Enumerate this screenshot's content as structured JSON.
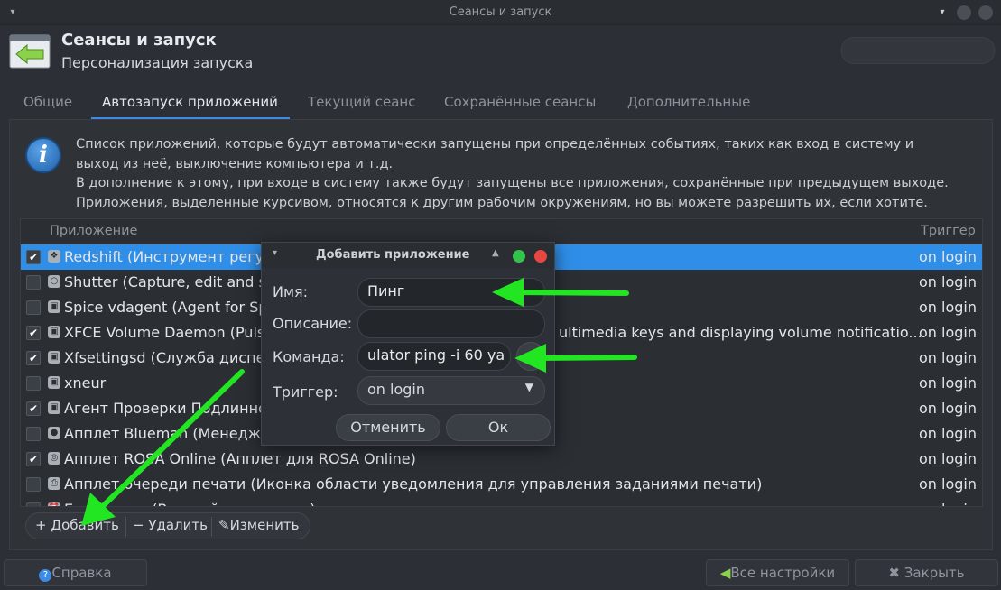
{
  "window": {
    "title": "Сеансы и запуск"
  },
  "header": {
    "title": "Сеансы и запуск",
    "subtitle": "Персонализация запуска"
  },
  "tabs": [
    {
      "label": "Общие"
    },
    {
      "label": "Автозапуск приложений"
    },
    {
      "label": "Текущий сеанс"
    },
    {
      "label": "Сохранённые сеансы"
    },
    {
      "label": "Дополнительные"
    }
  ],
  "active_tab": "Автозапуск приложений",
  "info": {
    "line1": "Список приложений, которые будут автоматически запущены при определённых событиях, таких как вход в систему и",
    "line2": "выход из неё, выключение компьютера и т.д.",
    "line3": "В дополнение к этому, при входе в систему также будут запущены все приложения, сохранённые при предыдущем выходе.",
    "line4": "Приложения, выделенные курсивом, относятся к другим рабочим окружениям, но вы можете разрешить их, если хотите."
  },
  "table": {
    "col_app": "Приложение",
    "col_trigger": "Триггер",
    "rows": [
      {
        "checked": true,
        "name": "Redshift (Инструмент регули",
        "trigger": "on login",
        "selected": true
      },
      {
        "checked": false,
        "name": "Shutter (Capture, edit and sh",
        "trigger": "on login"
      },
      {
        "checked": false,
        "name": "Spice vdagent (Agent for Spi",
        "trigger": "on login"
      },
      {
        "checked": true,
        "name": "XFCE Volume Daemon (Pulse",
        "trigger": "on login",
        "tail": "ultimedia keys and displaying volume notificatio..."
      },
      {
        "checked": true,
        "name": "Xfsettingsd (Служба диспетч",
        "trigger": "on login"
      },
      {
        "checked": false,
        "name": "xneur",
        "trigger": "on login"
      },
      {
        "checked": true,
        "name": "Агент Проверки Подлинност",
        "trigger": "on login"
      },
      {
        "checked": false,
        "name": "Апплет Blueman (Менеджер",
        "trigger": "on login"
      },
      {
        "checked": true,
        "name": "Апплет ROSA Online (Апплет для ROSA Online)",
        "trigger": "on login"
      },
      {
        "checked": false,
        "name": "Апплет очереди печати (Иконка области уведомления для управления заданиями печати)",
        "trigger": "on login"
      },
      {
        "checked": false,
        "name": "Будильник (Вставайте по утрам)",
        "trigger": "on login"
      }
    ]
  },
  "toolbar": {
    "add": "Добавить",
    "remove": "Удалить",
    "edit": "Изменить"
  },
  "footer": {
    "help": "Справка",
    "all_settings": "Все настройки",
    "close": "Закрыть"
  },
  "dialog": {
    "title": "Добавить приложение",
    "name_label": "Имя:",
    "name_value": "Пинг",
    "desc_label": "Описание:",
    "desc_value": "",
    "cmd_label": "Команда:",
    "cmd_value": "ulator ping -i 60 ya",
    "trigger_label": "Триггер:",
    "trigger_value": "on login",
    "cancel": "Отменить",
    "ok": "Ок"
  },
  "colors": {
    "accent": "#2f8ee8",
    "annotation_arrow": "#22e622"
  }
}
